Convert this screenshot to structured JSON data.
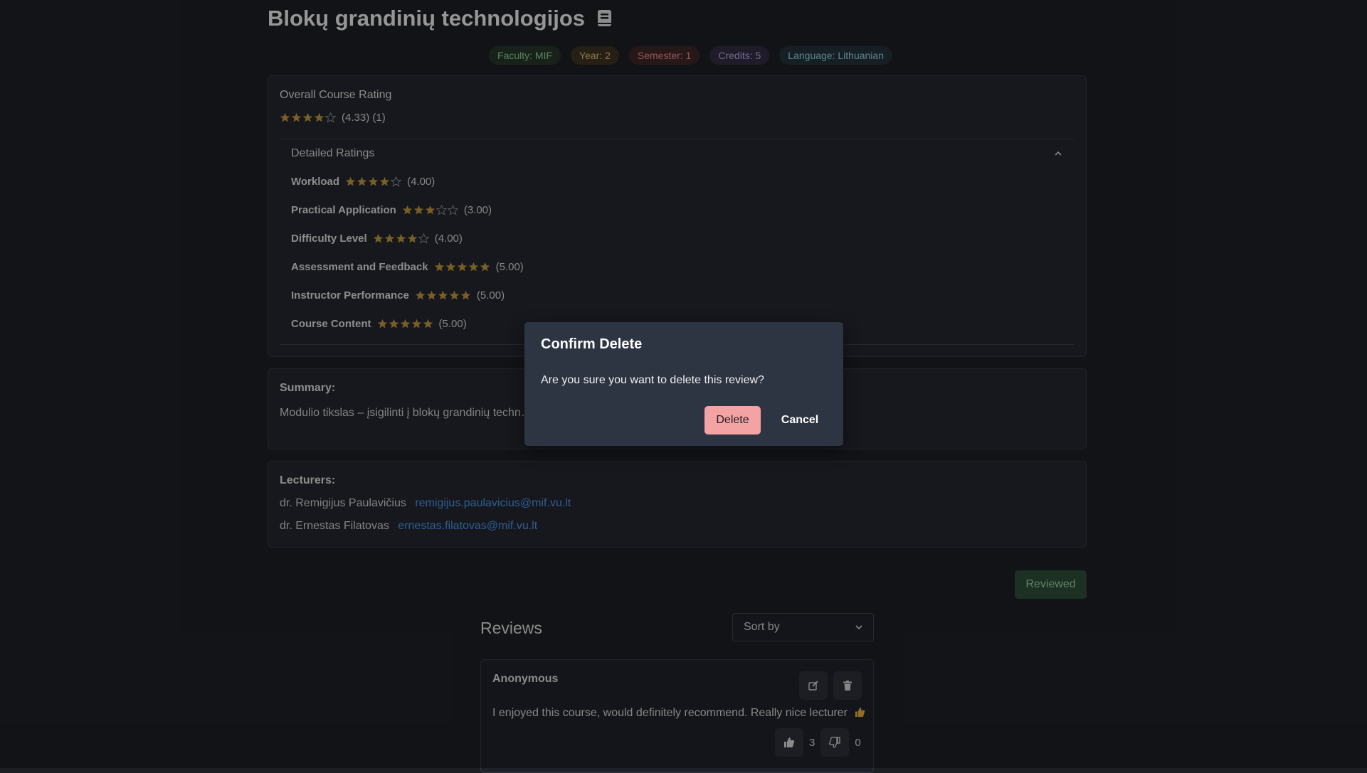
{
  "course": {
    "title": "Blokų grandinių technologijos",
    "badges": {
      "faculty": "Faculty: MIF",
      "year": "Year: 2",
      "semester": "Semester: 1",
      "credits": "Credits: 5",
      "language": "Language: Lithuanian"
    }
  },
  "rating": {
    "overall_label": "Overall Course Rating",
    "overall_value": 4.33,
    "overall_text": "(4.33) (1)",
    "detailed_label": "Detailed Ratings",
    "criteria": [
      {
        "name": "Workload",
        "value": 4,
        "text": "(4.00)"
      },
      {
        "name": "Practical Application",
        "value": 3,
        "text": "(3.00)"
      },
      {
        "name": "Difficulty Level",
        "value": 4,
        "text": "(4.00)"
      },
      {
        "name": "Assessment and Feedback",
        "value": 5,
        "text": "(5.00)"
      },
      {
        "name": "Instructor Performance",
        "value": 5,
        "text": "(5.00)"
      },
      {
        "name": "Course Content",
        "value": 5,
        "text": "(5.00)"
      }
    ]
  },
  "summary": {
    "label": "Summary:",
    "text": "Modulio tikslas – įsigilinti į blokų grandinių techn… išmokyti juos realizuojant 'blockchain' paremtus sprendimus."
  },
  "lecturers": {
    "label": "Lecturers:",
    "items": [
      {
        "name": "dr. Remigijus Paulavičius",
        "email": "remigijus.paulavicius@mif.vu.lt"
      },
      {
        "name": "dr. Ernestas Filatovas",
        "email": "ernestas.filatovas@mif.vu.lt"
      }
    ]
  },
  "actions": {
    "reviewed_label": "Reviewed"
  },
  "reviews": {
    "title": "Reviews",
    "sort_placeholder": "Sort by",
    "items": [
      {
        "author": "Anonymous",
        "text": "I enjoyed this course, would definitely recommend. Really nice lecturer",
        "upvotes": "3",
        "downvotes": "0"
      }
    ]
  },
  "modal": {
    "title": "Confirm Delete",
    "message": "Are you sure you want to delete this review?",
    "delete_label": "Delete",
    "cancel_label": "Cancel"
  },
  "colors": {
    "star": "#b8923a",
    "star_empty": "#8a8a8a",
    "link": "#4a90e2",
    "delete": "#f3a3a3"
  }
}
